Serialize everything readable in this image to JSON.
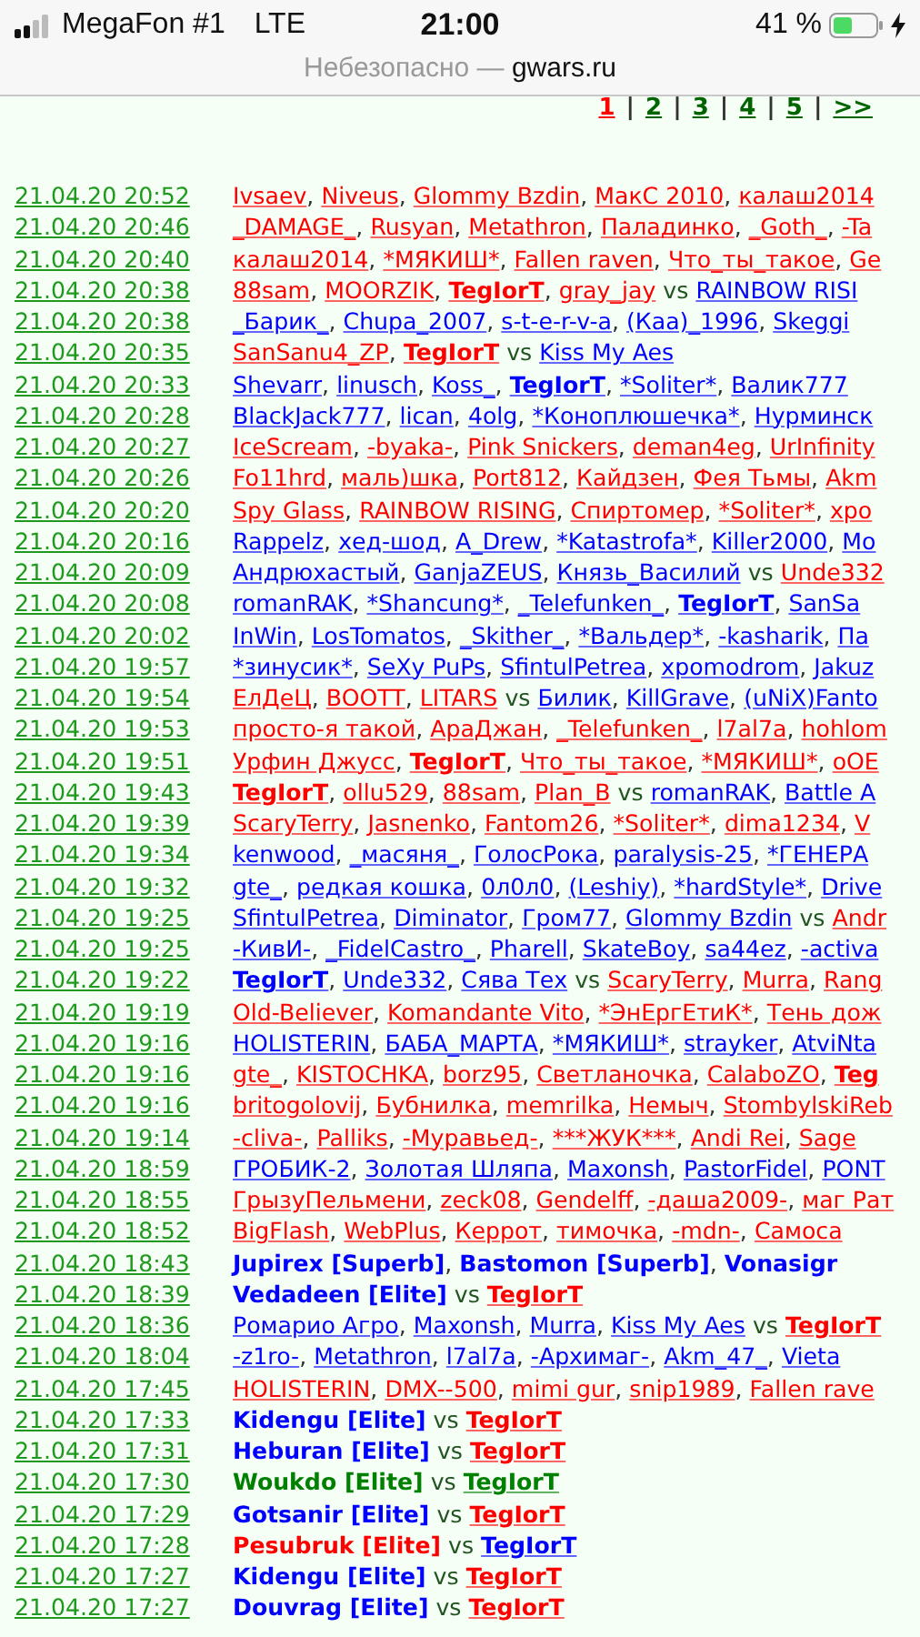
{
  "status_bar": {
    "carrier": "MegaFon #1",
    "network": "LTE",
    "time": "21:00",
    "battery": "41 %"
  },
  "address_bar": {
    "warning": "Небезопасно —",
    "host": "gwars.ru"
  },
  "pager": {
    "separator": "|",
    "pages": [
      {
        "label": "1",
        "selected": true
      },
      {
        "label": "2",
        "selected": false
      },
      {
        "label": "3",
        "selected": false
      },
      {
        "label": "4",
        "selected": false
      },
      {
        "label": "5",
        "selected": false
      },
      {
        "label": ">>",
        "selected": false
      }
    ]
  },
  "list_separator": ",",
  "rows": [
    {
      "date": "21.04.20 20:52",
      "sides": [
        [
          {
            "name": "Ivsaev",
            "color": "#ff0000",
            "kind": "player"
          },
          {
            "name": "Niveus",
            "color": "#ff0000",
            "kind": "player"
          },
          {
            "name": "Glommy Bzdin",
            "color": "#ff0000",
            "kind": "player"
          },
          {
            "name": "МакС 2010",
            "color": "#ff0000",
            "kind": "player"
          },
          {
            "name": "калаш2014",
            "color": "#ff0000",
            "kind": "player"
          }
        ]
      ]
    },
    {
      "date": "21.04.20 20:46",
      "sides": [
        [
          {
            "name": "_DAMAGE_",
            "color": "#ff0000",
            "kind": "player"
          },
          {
            "name": "Rusyan",
            "color": "#ff0000",
            "kind": "player"
          },
          {
            "name": "Metathron",
            "color": "#ff0000",
            "kind": "player"
          },
          {
            "name": "Паладинко",
            "color": "#ff0000",
            "kind": "player"
          },
          {
            "name": "_Goth_",
            "color": "#ff0000",
            "kind": "player"
          },
          {
            "name": "-Ta",
            "color": "#ff0000",
            "kind": "player"
          }
        ]
      ]
    },
    {
      "date": "21.04.20 20:40",
      "sides": [
        [
          {
            "name": "калаш2014",
            "color": "#ff0000",
            "kind": "player"
          },
          {
            "name": "*МЯКИШ*",
            "color": "#ff0000",
            "kind": "player"
          },
          {
            "name": "Fallen raven",
            "color": "#ff0000",
            "kind": "player"
          },
          {
            "name": "Что_ты_такое",
            "color": "#ff0000",
            "kind": "player"
          },
          {
            "name": "Ge",
            "color": "#ff0000",
            "kind": "player"
          }
        ]
      ]
    },
    {
      "date": "21.04.20 20:38",
      "versus": "vs",
      "sides": [
        [
          {
            "name": "88sam",
            "color": "#ff0000",
            "kind": "player"
          },
          {
            "name": "MOORZIK",
            "color": "#ff0000",
            "kind": "player"
          },
          {
            "name": "TegIorT",
            "color": "#ff0000",
            "kind": "self"
          },
          {
            "name": "gray_jay",
            "color": "#ff0000",
            "kind": "player"
          }
        ],
        [
          {
            "name": "RAINBOW RISI",
            "color": "#0000ff",
            "kind": "player"
          }
        ]
      ]
    },
    {
      "date": "21.04.20 20:38",
      "sides": [
        [
          {
            "name": "_Барик_",
            "color": "#0000ff",
            "kind": "player"
          },
          {
            "name": "Chupa_2007",
            "color": "#0000ff",
            "kind": "player"
          },
          {
            "name": "s-t-e-r-v-a",
            "color": "#0000ff",
            "kind": "player"
          },
          {
            "name": "(Каа)_1996",
            "color": "#0000ff",
            "kind": "player"
          },
          {
            "name": "Skeggi",
            "color": "#0000ff",
            "kind": "player"
          }
        ]
      ]
    },
    {
      "date": "21.04.20 20:35",
      "versus": "vs",
      "sides": [
        [
          {
            "name": "SanSanu4_ZP",
            "color": "#ff0000",
            "kind": "player"
          },
          {
            "name": "TegIorT",
            "color": "#ff0000",
            "kind": "self"
          }
        ],
        [
          {
            "name": "Kiss My Aes",
            "color": "#0000ff",
            "kind": "player"
          }
        ]
      ]
    },
    {
      "date": "21.04.20 20:33",
      "sides": [
        [
          {
            "name": "Shevarr",
            "color": "#0000ff",
            "kind": "player"
          },
          {
            "name": "linusch",
            "color": "#0000ff",
            "kind": "player"
          },
          {
            "name": "Koss_",
            "color": "#0000ff",
            "kind": "player"
          },
          {
            "name": "TegIorT",
            "color": "#0000ff",
            "kind": "self"
          },
          {
            "name": "*Soliter*",
            "color": "#0000ff",
            "kind": "player"
          },
          {
            "name": "Валик777",
            "color": "#0000ff",
            "kind": "player"
          }
        ]
      ]
    },
    {
      "date": "21.04.20 20:28",
      "sides": [
        [
          {
            "name": "BlackJack777",
            "color": "#0000ff",
            "kind": "player"
          },
          {
            "name": "lican",
            "color": "#0000ff",
            "kind": "player"
          },
          {
            "name": "4olg",
            "color": "#0000ff",
            "kind": "player"
          },
          {
            "name": "*Коноплюшечка*",
            "color": "#0000ff",
            "kind": "player"
          },
          {
            "name": "Нурминск",
            "color": "#0000ff",
            "kind": "player"
          }
        ]
      ]
    },
    {
      "date": "21.04.20 20:27",
      "sides": [
        [
          {
            "name": "IceScream",
            "color": "#ff0000",
            "kind": "player"
          },
          {
            "name": "-byaka-",
            "color": "#ff0000",
            "kind": "player"
          },
          {
            "name": "Pink Snickers",
            "color": "#ff0000",
            "kind": "player"
          },
          {
            "name": "deman4eg",
            "color": "#ff0000",
            "kind": "player"
          },
          {
            "name": "UrInfinity",
            "color": "#ff0000",
            "kind": "player"
          }
        ]
      ]
    },
    {
      "date": "21.04.20 20:26",
      "sides": [
        [
          {
            "name": "Fo11hrd",
            "color": "#ff0000",
            "kind": "player"
          },
          {
            "name": "маль)шка",
            "color": "#ff0000",
            "kind": "player"
          },
          {
            "name": "Port812",
            "color": "#ff0000",
            "kind": "player"
          },
          {
            "name": "Кайдзен",
            "color": "#ff0000",
            "kind": "player"
          },
          {
            "name": "Фея Тьмы",
            "color": "#ff0000",
            "kind": "player"
          },
          {
            "name": "Akm",
            "color": "#ff0000",
            "kind": "player"
          }
        ]
      ]
    },
    {
      "date": "21.04.20 20:20",
      "sides": [
        [
          {
            "name": "Spy Glass",
            "color": "#ff0000",
            "kind": "player"
          },
          {
            "name": "RAINBOW RISING",
            "color": "#ff0000",
            "kind": "player"
          },
          {
            "name": "Спиртомер",
            "color": "#ff0000",
            "kind": "player"
          },
          {
            "name": "*Soliter*",
            "color": "#ff0000",
            "kind": "player"
          },
          {
            "name": "хро",
            "color": "#ff0000",
            "kind": "player"
          }
        ]
      ]
    },
    {
      "date": "21.04.20 20:16",
      "sides": [
        [
          {
            "name": "Rappelz",
            "color": "#0000ff",
            "kind": "player"
          },
          {
            "name": "хед-шод",
            "color": "#0000ff",
            "kind": "player"
          },
          {
            "name": "A_Drew",
            "color": "#0000ff",
            "kind": "player"
          },
          {
            "name": "*Katastrofa*",
            "color": "#0000ff",
            "kind": "player"
          },
          {
            "name": "Killer2000",
            "color": "#0000ff",
            "kind": "player"
          },
          {
            "name": "Mo",
            "color": "#0000ff",
            "kind": "player"
          }
        ]
      ]
    },
    {
      "date": "21.04.20 20:09",
      "versus": "vs",
      "sides": [
        [
          {
            "name": "Андрюхастый",
            "color": "#0000ff",
            "kind": "player"
          },
          {
            "name": "GanjaZEUS",
            "color": "#0000ff",
            "kind": "player"
          },
          {
            "name": "Князь_Василий",
            "color": "#0000ff",
            "kind": "player"
          }
        ],
        [
          {
            "name": "Unde332",
            "color": "#ff0000",
            "kind": "player"
          }
        ]
      ]
    },
    {
      "date": "21.04.20 20:08",
      "sides": [
        [
          {
            "name": "romanRAK",
            "color": "#0000ff",
            "kind": "player"
          },
          {
            "name": "*Shancung*",
            "color": "#0000ff",
            "kind": "player"
          },
          {
            "name": "_Telefunken_",
            "color": "#0000ff",
            "kind": "player"
          },
          {
            "name": "TegIorT",
            "color": "#0000ff",
            "kind": "self"
          },
          {
            "name": "SanSa",
            "color": "#0000ff",
            "kind": "player"
          }
        ]
      ]
    },
    {
      "date": "21.04.20 20:02",
      "sides": [
        [
          {
            "name": "InWin",
            "color": "#0000ff",
            "kind": "player"
          },
          {
            "name": "LosTomatos",
            "color": "#0000ff",
            "kind": "player"
          },
          {
            "name": "_Skither_",
            "color": "#0000ff",
            "kind": "player"
          },
          {
            "name": "*Вальдер*",
            "color": "#0000ff",
            "kind": "player"
          },
          {
            "name": "-kasharik",
            "color": "#0000ff",
            "kind": "player"
          },
          {
            "name": "Па",
            "color": "#0000ff",
            "kind": "player"
          }
        ]
      ]
    },
    {
      "date": "21.04.20 19:57",
      "sides": [
        [
          {
            "name": "*зинусик*",
            "color": "#0000ff",
            "kind": "player"
          },
          {
            "name": "SeXy PuPs",
            "color": "#0000ff",
            "kind": "player"
          },
          {
            "name": "SfintulPetrea",
            "color": "#0000ff",
            "kind": "player"
          },
          {
            "name": "xpomodrom",
            "color": "#0000ff",
            "kind": "player"
          },
          {
            "name": "Jakuz",
            "color": "#0000ff",
            "kind": "player"
          }
        ]
      ]
    },
    {
      "date": "21.04.20 19:54",
      "versus": "vs",
      "sides": [
        [
          {
            "name": "ЕлДеЦ",
            "color": "#ff0000",
            "kind": "player"
          },
          {
            "name": "BOOTT",
            "color": "#ff0000",
            "kind": "player"
          },
          {
            "name": "LITARS",
            "color": "#ff0000",
            "kind": "player"
          }
        ],
        [
          {
            "name": "Билик",
            "color": "#0000ff",
            "kind": "player"
          },
          {
            "name": "KillGrave",
            "color": "#0000ff",
            "kind": "player"
          },
          {
            "name": "(uNiX)Fanto",
            "color": "#0000ff",
            "kind": "player"
          }
        ]
      ]
    },
    {
      "date": "21.04.20 19:53",
      "sides": [
        [
          {
            "name": "просто-я такой",
            "color": "#ff0000",
            "kind": "player"
          },
          {
            "name": "АраДжан",
            "color": "#ff0000",
            "kind": "player"
          },
          {
            "name": "_Telefunken_",
            "color": "#ff0000",
            "kind": "player"
          },
          {
            "name": "l7al7a",
            "color": "#ff0000",
            "kind": "player"
          },
          {
            "name": "hohlom",
            "color": "#ff0000",
            "kind": "player"
          }
        ]
      ]
    },
    {
      "date": "21.04.20 19:51",
      "sides": [
        [
          {
            "name": "Урфин Джусс",
            "color": "#ff0000",
            "kind": "player"
          },
          {
            "name": "TegIorT",
            "color": "#ff0000",
            "kind": "self"
          },
          {
            "name": "Что_ты_такое",
            "color": "#ff0000",
            "kind": "player"
          },
          {
            "name": "*МЯКИШ*",
            "color": "#ff0000",
            "kind": "player"
          },
          {
            "name": "oOE",
            "color": "#ff0000",
            "kind": "player"
          }
        ]
      ]
    },
    {
      "date": "21.04.20 19:43",
      "versus": "vs",
      "sides": [
        [
          {
            "name": "TegIorT",
            "color": "#ff0000",
            "kind": "self"
          },
          {
            "name": "ollu529",
            "color": "#ff0000",
            "kind": "player"
          },
          {
            "name": "88sam",
            "color": "#ff0000",
            "kind": "player"
          },
          {
            "name": "Plan_B",
            "color": "#ff0000",
            "kind": "player"
          }
        ],
        [
          {
            "name": "romanRAK",
            "color": "#0000ff",
            "kind": "player"
          },
          {
            "name": "Battle A",
            "color": "#0000ff",
            "kind": "player"
          }
        ]
      ]
    },
    {
      "date": "21.04.20 19:39",
      "sides": [
        [
          {
            "name": "ScaryTerry",
            "color": "#ff0000",
            "kind": "player"
          },
          {
            "name": "Jasnenko",
            "color": "#ff0000",
            "kind": "player"
          },
          {
            "name": "Fantom26",
            "color": "#ff0000",
            "kind": "player"
          },
          {
            "name": "*Soliter*",
            "color": "#ff0000",
            "kind": "player"
          },
          {
            "name": "dima1234",
            "color": "#ff0000",
            "kind": "player"
          },
          {
            "name": "V",
            "color": "#ff0000",
            "kind": "player"
          }
        ]
      ]
    },
    {
      "date": "21.04.20 19:34",
      "sides": [
        [
          {
            "name": "kenwood",
            "color": "#0000ff",
            "kind": "player"
          },
          {
            "name": "_масяня_",
            "color": "#0000ff",
            "kind": "player"
          },
          {
            "name": "ГолосРока",
            "color": "#0000ff",
            "kind": "player"
          },
          {
            "name": "paralysis-25",
            "color": "#0000ff",
            "kind": "player"
          },
          {
            "name": "*ГЕНЕРА",
            "color": "#0000ff",
            "kind": "player"
          }
        ]
      ]
    },
    {
      "date": "21.04.20 19:32",
      "sides": [
        [
          {
            "name": "gte_",
            "color": "#0000ff",
            "kind": "player"
          },
          {
            "name": "редкая кошка",
            "color": "#0000ff",
            "kind": "player"
          },
          {
            "name": "0л0л0",
            "color": "#0000ff",
            "kind": "player"
          },
          {
            "name": "(Leshiy)",
            "color": "#0000ff",
            "kind": "player"
          },
          {
            "name": "*hardStyle*",
            "color": "#0000ff",
            "kind": "player"
          },
          {
            "name": "Drive",
            "color": "#0000ff",
            "kind": "player"
          }
        ]
      ]
    },
    {
      "date": "21.04.20 19:25",
      "versus": "vs",
      "sides": [
        [
          {
            "name": "SfintulPetrea",
            "color": "#0000ff",
            "kind": "player"
          },
          {
            "name": "Diminator",
            "color": "#0000ff",
            "kind": "player"
          },
          {
            "name": "Гром77",
            "color": "#0000ff",
            "kind": "player"
          },
          {
            "name": "Glommy Bzdin",
            "color": "#0000ff",
            "kind": "player"
          }
        ],
        [
          {
            "name": "Andr",
            "color": "#ff0000",
            "kind": "player"
          }
        ]
      ]
    },
    {
      "date": "21.04.20 19:25",
      "sides": [
        [
          {
            "name": "-КивИ-",
            "color": "#0000ff",
            "kind": "player"
          },
          {
            "name": "_FidelCastro_",
            "color": "#0000ff",
            "kind": "player"
          },
          {
            "name": "Pharell",
            "color": "#0000ff",
            "kind": "player"
          },
          {
            "name": "SkateBoy",
            "color": "#0000ff",
            "kind": "player"
          },
          {
            "name": "sa44ez",
            "color": "#0000ff",
            "kind": "player"
          },
          {
            "name": "-activa",
            "color": "#0000ff",
            "kind": "player"
          }
        ]
      ]
    },
    {
      "date": "21.04.20 19:22",
      "versus": "vs",
      "sides": [
        [
          {
            "name": "TegIorT",
            "color": "#0000ff",
            "kind": "self"
          },
          {
            "name": "Unde332",
            "color": "#0000ff",
            "kind": "player"
          },
          {
            "name": "Сява Тех",
            "color": "#0000ff",
            "kind": "player"
          }
        ],
        [
          {
            "name": "ScaryTerry",
            "color": "#ff0000",
            "kind": "player"
          },
          {
            "name": "Murra",
            "color": "#ff0000",
            "kind": "player"
          },
          {
            "name": "Rang",
            "color": "#ff0000",
            "kind": "player"
          }
        ]
      ]
    },
    {
      "date": "21.04.20 19:19",
      "sides": [
        [
          {
            "name": "Old-Believer",
            "color": "#ff0000",
            "kind": "player"
          },
          {
            "name": "Komandante Vito",
            "color": "#ff0000",
            "kind": "player"
          },
          {
            "name": "*ЭнЕргЕтиК*",
            "color": "#ff0000",
            "kind": "player"
          },
          {
            "name": "Тень дож",
            "color": "#ff0000",
            "kind": "player"
          }
        ]
      ]
    },
    {
      "date": "21.04.20 19:16",
      "sides": [
        [
          {
            "name": "HOLISTERIN",
            "color": "#0000ff",
            "kind": "player"
          },
          {
            "name": "БАБА_МАРТА",
            "color": "#0000ff",
            "kind": "player"
          },
          {
            "name": "*МЯКИШ*",
            "color": "#0000ff",
            "kind": "player"
          },
          {
            "name": "strayker",
            "color": "#0000ff",
            "kind": "player"
          },
          {
            "name": "AtviNta",
            "color": "#0000ff",
            "kind": "player"
          }
        ]
      ]
    },
    {
      "date": "21.04.20 19:16",
      "sides": [
        [
          {
            "name": "gte_",
            "color": "#ff0000",
            "kind": "player"
          },
          {
            "name": "KISTOCHKA",
            "color": "#ff0000",
            "kind": "player"
          },
          {
            "name": "borz95",
            "color": "#ff0000",
            "kind": "player"
          },
          {
            "name": "Светланочка",
            "color": "#ff0000",
            "kind": "player"
          },
          {
            "name": "CalaboZO",
            "color": "#ff0000",
            "kind": "player"
          },
          {
            "name": "Teg",
            "color": "#ff0000",
            "kind": "self"
          }
        ]
      ]
    },
    {
      "date": "21.04.20 19:16",
      "sides": [
        [
          {
            "name": "britogolovij",
            "color": "#ff0000",
            "kind": "player"
          },
          {
            "name": "Бубнилка",
            "color": "#ff0000",
            "kind": "player"
          },
          {
            "name": "memrilka",
            "color": "#ff0000",
            "kind": "player"
          },
          {
            "name": "Немыч",
            "color": "#ff0000",
            "kind": "player"
          },
          {
            "name": "StombylskiReb",
            "color": "#ff0000",
            "kind": "player"
          }
        ]
      ]
    },
    {
      "date": "21.04.20 19:14",
      "sides": [
        [
          {
            "name": "-cliva-",
            "color": "#ff0000",
            "kind": "player"
          },
          {
            "name": "Palliks",
            "color": "#ff0000",
            "kind": "player"
          },
          {
            "name": "-Муравьед-",
            "color": "#ff0000",
            "kind": "player"
          },
          {
            "name": "***ЖУК***",
            "color": "#ff0000",
            "kind": "player"
          },
          {
            "name": "Andi Rei",
            "color": "#ff0000",
            "kind": "player"
          },
          {
            "name": "Sage",
            "color": "#ff0000",
            "kind": "player"
          }
        ]
      ]
    },
    {
      "date": "21.04.20 18:59",
      "sides": [
        [
          {
            "name": "ГРОБИК-2",
            "color": "#0000ff",
            "kind": "player"
          },
          {
            "name": "Золотая Шляпа",
            "color": "#0000ff",
            "kind": "player"
          },
          {
            "name": "Maxonsh",
            "color": "#0000ff",
            "kind": "player"
          },
          {
            "name": "PastorFidel",
            "color": "#0000ff",
            "kind": "player"
          },
          {
            "name": "PONT",
            "color": "#0000ff",
            "kind": "player"
          }
        ]
      ]
    },
    {
      "date": "21.04.20 18:55",
      "sides": [
        [
          {
            "name": "ГрызуПельмени",
            "color": "#ff0000",
            "kind": "player"
          },
          {
            "name": "zeck08",
            "color": "#ff0000",
            "kind": "player"
          },
          {
            "name": "Gendelff",
            "color": "#ff0000",
            "kind": "player"
          },
          {
            "name": "-даша2009-",
            "color": "#ff0000",
            "kind": "player"
          },
          {
            "name": "маг Рат",
            "color": "#ff0000",
            "kind": "player"
          }
        ]
      ]
    },
    {
      "date": "21.04.20 18:52",
      "sides": [
        [
          {
            "name": "BigFlash",
            "color": "#ff0000",
            "kind": "player"
          },
          {
            "name": "WebPlus",
            "color": "#ff0000",
            "kind": "player"
          },
          {
            "name": "Керрот",
            "color": "#ff0000",
            "kind": "player"
          },
          {
            "name": "тимочка",
            "color": "#ff0000",
            "kind": "player"
          },
          {
            "name": "-mdn-",
            "color": "#ff0000",
            "kind": "player"
          },
          {
            "name": "Самоса",
            "color": "#ff0000",
            "kind": "player"
          }
        ]
      ]
    },
    {
      "date": "21.04.20 18:43",
      "sides": [
        [
          {
            "name": "Jupirex [Superb]",
            "color": "#0000ff",
            "kind": "npc"
          },
          {
            "name": "Bastomon [Superb]",
            "color": "#0000ff",
            "kind": "npc"
          },
          {
            "name": "Vonasigr",
            "color": "#0000ff",
            "kind": "npc"
          }
        ]
      ]
    },
    {
      "date": "21.04.20 18:39",
      "versus": "vs",
      "sides": [
        [
          {
            "name": "Vedadeen [Elite]",
            "color": "#0000ff",
            "kind": "npc"
          }
        ],
        [
          {
            "name": "TegIorT",
            "color": "#ff0000",
            "kind": "self"
          }
        ]
      ]
    },
    {
      "date": "21.04.20 18:36",
      "versus": "vs",
      "sides": [
        [
          {
            "name": "Ромарио Агро",
            "color": "#0000ff",
            "kind": "player"
          },
          {
            "name": "Maxonsh",
            "color": "#0000ff",
            "kind": "player"
          },
          {
            "name": "Murra",
            "color": "#0000ff",
            "kind": "player"
          },
          {
            "name": "Kiss My Aes",
            "color": "#0000ff",
            "kind": "player"
          }
        ],
        [
          {
            "name": "TegIorT",
            "color": "#ff0000",
            "kind": "self"
          }
        ]
      ]
    },
    {
      "date": "21.04.20 18:04",
      "sides": [
        [
          {
            "name": "-z1ro-",
            "color": "#0000ff",
            "kind": "player"
          },
          {
            "name": "Metathron",
            "color": "#0000ff",
            "kind": "player"
          },
          {
            "name": "l7al7a",
            "color": "#0000ff",
            "kind": "player"
          },
          {
            "name": "-Архимаг-",
            "color": "#0000ff",
            "kind": "player"
          },
          {
            "name": "Akm_47_",
            "color": "#0000ff",
            "kind": "player"
          },
          {
            "name": "Vieta",
            "color": "#0000ff",
            "kind": "player"
          }
        ]
      ]
    },
    {
      "date": "21.04.20 17:45",
      "sides": [
        [
          {
            "name": "HOLISTERIN",
            "color": "#ff0000",
            "kind": "player"
          },
          {
            "name": "DMX--500",
            "color": "#ff0000",
            "kind": "player"
          },
          {
            "name": "mimi gur",
            "color": "#ff0000",
            "kind": "player"
          },
          {
            "name": "snip1989",
            "color": "#ff0000",
            "kind": "player"
          },
          {
            "name": "Fallen rave",
            "color": "#ff0000",
            "kind": "player"
          }
        ]
      ]
    },
    {
      "date": "21.04.20 17:33",
      "versus": "vs",
      "sides": [
        [
          {
            "name": "Kidengu [Elite]",
            "color": "#0000ff",
            "kind": "npc"
          }
        ],
        [
          {
            "name": "TegIorT",
            "color": "#ff0000",
            "kind": "self"
          }
        ]
      ]
    },
    {
      "date": "21.04.20 17:31",
      "versus": "vs",
      "sides": [
        [
          {
            "name": "Heburan [Elite]",
            "color": "#0000ff",
            "kind": "npc"
          }
        ],
        [
          {
            "name": "TegIorT",
            "color": "#ff0000",
            "kind": "self"
          }
        ]
      ]
    },
    {
      "date": "21.04.20 17:30",
      "versus": "vs",
      "sides": [
        [
          {
            "name": "Woukdo [Elite]",
            "color": "#008000",
            "kind": "npc"
          }
        ],
        [
          {
            "name": "TegIorT",
            "color": "#008000",
            "kind": "self"
          }
        ]
      ]
    },
    {
      "date": "21.04.20 17:29",
      "versus": "vs",
      "sides": [
        [
          {
            "name": "Gotsanir [Elite]",
            "color": "#0000ff",
            "kind": "npc"
          }
        ],
        [
          {
            "name": "TegIorT",
            "color": "#ff0000",
            "kind": "self"
          }
        ]
      ]
    },
    {
      "date": "21.04.20 17:28",
      "versus": "vs",
      "sides": [
        [
          {
            "name": "Pesubruk [Elite]",
            "color": "#ff0000",
            "kind": "npc"
          }
        ],
        [
          {
            "name": "TegIorT",
            "color": "#0000ff",
            "kind": "self"
          }
        ]
      ]
    },
    {
      "date": "21.04.20 17:27",
      "versus": "vs",
      "sides": [
        [
          {
            "name": "Kidengu [Elite]",
            "color": "#0000ff",
            "kind": "npc"
          }
        ],
        [
          {
            "name": "TegIorT",
            "color": "#ff0000",
            "kind": "self"
          }
        ]
      ]
    },
    {
      "date": "21.04.20 17:27",
      "versus": "vs",
      "sides": [
        [
          {
            "name": "Douvrag [Elite]",
            "color": "#0000ff",
            "kind": "npc"
          }
        ],
        [
          {
            "name": "TegIorT",
            "color": "#ff0000",
            "kind": "self"
          }
        ]
      ]
    }
  ]
}
